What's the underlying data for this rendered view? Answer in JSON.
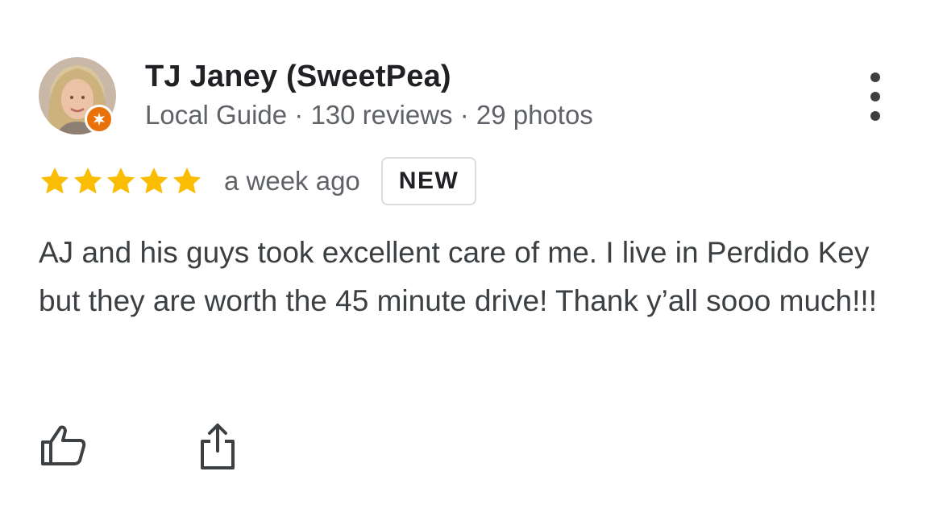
{
  "review": {
    "author": {
      "name": "TJ Janey (SweetPea)",
      "meta": "Local Guide · 130 reviews · 29 photos",
      "badge_icon": "local-guide-star-icon",
      "badge_color": "#e8710a"
    },
    "rating": 5,
    "rating_color": "#fbbc04",
    "time": "a week ago",
    "badge": "NEW",
    "text": "AJ and his guys took excellent care of me. I live in Perdido Key but they are worth the 45 minute drive! Thank y’all sooo much!!!"
  },
  "actions": {
    "like_icon": "thumbs-up-icon",
    "share_icon": "share-icon",
    "more_icon": "more-vert-icon"
  }
}
